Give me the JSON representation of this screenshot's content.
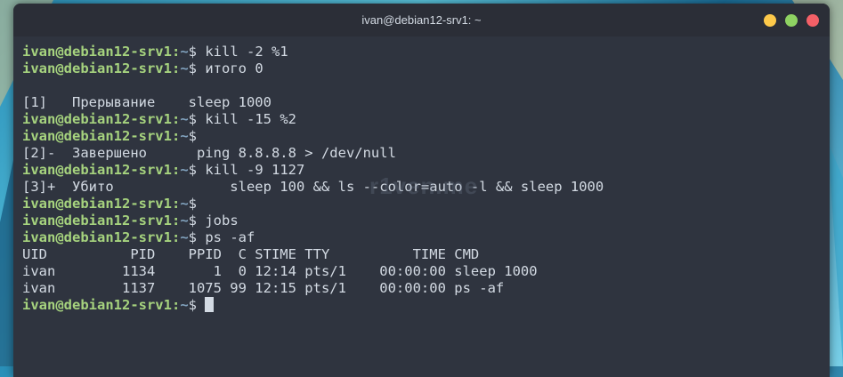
{
  "window": {
    "title": "ivan@debian12-srv1: ~"
  },
  "prompt": {
    "user_host": "ivan@debian12-srv1",
    "sep": ":",
    "path": "~",
    "symbol": "$"
  },
  "lines": [
    {
      "type": "prompt",
      "cmd": " kill -2 %1"
    },
    {
      "type": "prompt",
      "cmd": " итого 0"
    },
    {
      "type": "text",
      "text": ""
    },
    {
      "type": "text",
      "text": "[1]   Прерывание    sleep 1000"
    },
    {
      "type": "prompt",
      "cmd": " kill -15 %2"
    },
    {
      "type": "prompt",
      "cmd": ""
    },
    {
      "type": "text",
      "text": "[2]-  Завершено      ping 8.8.8.8 > /dev/null"
    },
    {
      "type": "prompt",
      "cmd": " kill -9 1127"
    },
    {
      "type": "text",
      "text": "[3]+  Убито              sleep 100 && ls --color=auto -l && sleep 1000"
    },
    {
      "type": "prompt",
      "cmd": ""
    },
    {
      "type": "prompt",
      "cmd": " jobs"
    },
    {
      "type": "prompt",
      "cmd": " ps -af"
    },
    {
      "type": "text",
      "text": "UID          PID    PPID  C STIME TTY          TIME CMD"
    },
    {
      "type": "text",
      "text": "ivan        1134       1  0 12:14 pts/1    00:00:00 sleep 1000"
    },
    {
      "type": "text",
      "text": "ivan        1137    1075 99 12:15 pts/1    00:00:00 ps -af"
    },
    {
      "type": "prompt",
      "cmd": " ",
      "cursor": true
    }
  ],
  "watermark": "r1ven.me"
}
